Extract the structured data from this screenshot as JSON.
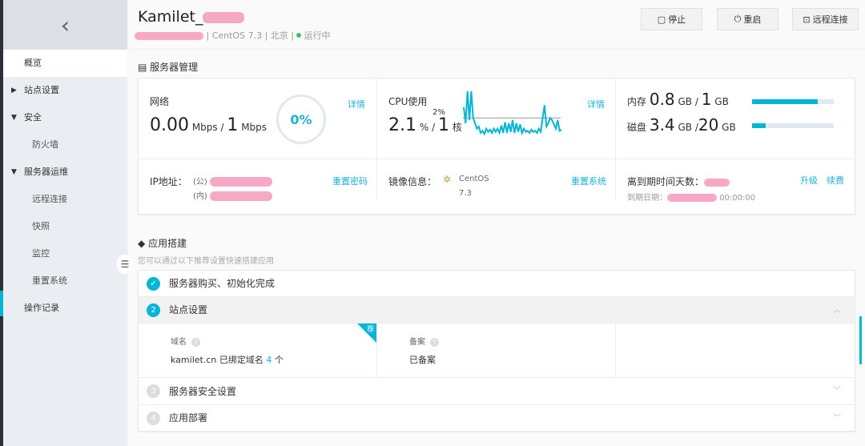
{
  "sidebar": {
    "back_icon": "chevron-left-icon",
    "items": [
      {
        "label": "概览",
        "active": true
      },
      {
        "label": "站点设置",
        "arrow": "▶"
      },
      {
        "label": "安全",
        "arrow": "▼"
      },
      {
        "label": "防火墙",
        "sub": true
      },
      {
        "label": "服务器运维",
        "arrow": "▼"
      },
      {
        "label": "远程连接",
        "sub": true
      },
      {
        "label": "快照",
        "sub": true
      },
      {
        "label": "监控",
        "sub": true
      },
      {
        "label": "重置系统",
        "sub": true
      },
      {
        "label": "操作记录"
      }
    ]
  },
  "header": {
    "title": "Kamilet_",
    "os": "| CentOS 7.3 | 北京 |",
    "status": "运行中",
    "status_color": "#3ec26b",
    "buttons": [
      {
        "label": "停止",
        "icon": "square-icon"
      },
      {
        "label": "重启",
        "icon": "power-icon"
      },
      {
        "label": "远程连接",
        "icon": "terminal-icon"
      }
    ]
  },
  "server": {
    "title": "服务器管理",
    "network": {
      "label": "网络",
      "value": "0.00",
      "unit": "Mbps",
      "sep": "/",
      "max": "1",
      "max_unit": "Mbps",
      "gauge": "0%",
      "detail": "详情"
    },
    "cpu": {
      "label": "CPU使用",
      "value": "2.1",
      "unit": "%",
      "sep": "/",
      "cores": "1",
      "cores_unit": "核",
      "ref": "2%",
      "detail": "详情",
      "history": [
        3,
        1.5,
        4.5,
        1.8,
        4.5,
        2,
        1.5,
        1,
        1.2,
        0.6,
        0.8,
        0.5,
        1,
        0.7,
        0.9,
        0.6,
        1,
        0.7,
        1,
        0.6,
        1.3,
        0.6,
        1.6,
        0.6,
        1.5,
        0.7,
        1.8,
        0.6,
        1.5,
        0.7,
        1.4,
        0.6,
        1,
        0.7,
        0.8,
        0.6,
        0.9,
        0.7,
        0.8,
        0.6,
        1,
        0.7,
        2,
        3.2,
        1.2,
        1.5,
        2,
        1.8,
        1.4,
        1,
        1.8,
        0.8,
        0.9
      ]
    },
    "memory": {
      "label": "内存",
      "value": "0.8",
      "unit": "GB",
      "sep": "/",
      "max": "1",
      "max_unit": "GB",
      "fraction": 0.8
    },
    "disk": {
      "label": "磁盘",
      "value": "3.4",
      "unit": "GB",
      "sep": "/",
      "max": "20",
      "max_unit": "GB",
      "fraction": 0.17
    },
    "ip": {
      "label": "IP地址：",
      "public": "(公)",
      "private": "(内)",
      "action": "重置密码"
    },
    "image": {
      "label": "镜像信息：",
      "name": "CentOS",
      "version": "7.3",
      "action": "重置系统"
    },
    "expiry": {
      "label": "离到期时间天数：",
      "date_label": "到期日期：",
      "time": "00:00:00",
      "upgrade": "升级",
      "renew": "续费"
    }
  },
  "app": {
    "title": "应用搭建",
    "subtitle": "您可以通过以下推荐设置快速搭建应用",
    "steps": [
      {
        "num": "✓",
        "label": "服务器购买、初始化完成"
      },
      {
        "num": "2",
        "label": "站点设置"
      },
      {
        "num": "3",
        "label": "服务器安全设置"
      },
      {
        "num": "4",
        "label": "应用部署"
      }
    ],
    "domain": {
      "label": "域名",
      "value": "kamilet.cn 已绑定域名",
      "count": "4",
      "suffix": "个",
      "badge": "荐"
    },
    "icp": {
      "label": "备案",
      "value": "已备案"
    }
  },
  "colors": {
    "accent": "#00b5d6"
  }
}
